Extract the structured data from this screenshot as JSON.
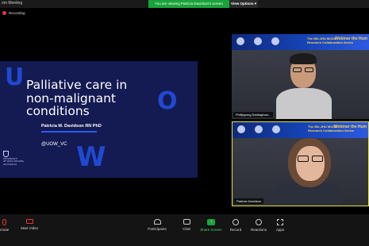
{
  "window": {
    "title": "om Meeting",
    "share_banner": "You are viewing Patricia Davidson's screen",
    "view_options": "View Options ▾"
  },
  "recording": {
    "label": "Recording"
  },
  "slide": {
    "letters": [
      "U",
      "O",
      "W"
    ],
    "title": "Palliative care in\nnon-malignant\nconditions",
    "author": "Patricia M. Davidson RN PhD",
    "handle": "@UOW_VC",
    "university": "UNIVERSITY\nOF WOLLONGONG\nAUSTRALIA"
  },
  "participants": [
    {
      "name": "Phillippong Sarikaphan...",
      "banner_webinar": "Webinar\nthe Hum",
      "banner_sub": "The MU-JHU MCDs\nResearch Collaboration Series",
      "active_speaker": false
    },
    {
      "name": "Patricia Davidson",
      "banner_webinar": "Webinar\nthe Hum",
      "banner_sub": "The MU-JHU MCDs\nResearch Collaboration Series",
      "active_speaker": true
    }
  ],
  "toolbar": {
    "items": [
      {
        "label": "nmute",
        "icon": "microphone-muted-icon"
      },
      {
        "label": "Start Video",
        "icon": "video-off-icon"
      },
      {
        "label": "Participants",
        "icon": "participants-icon"
      },
      {
        "label": "Chat",
        "icon": "chat-icon"
      },
      {
        "label": "Share Screen",
        "icon": "share-screen-icon"
      },
      {
        "label": "Record",
        "icon": "record-icon"
      },
      {
        "label": "Reactions",
        "icon": "reactions-icon"
      },
      {
        "label": "Apps",
        "icon": "apps-icon"
      }
    ]
  },
  "colors": {
    "slide_bg": "#141a52",
    "slide_accent": "#1f49d1",
    "share_green": "#1aa33b",
    "active_speaker_border": "#e6e23a"
  }
}
